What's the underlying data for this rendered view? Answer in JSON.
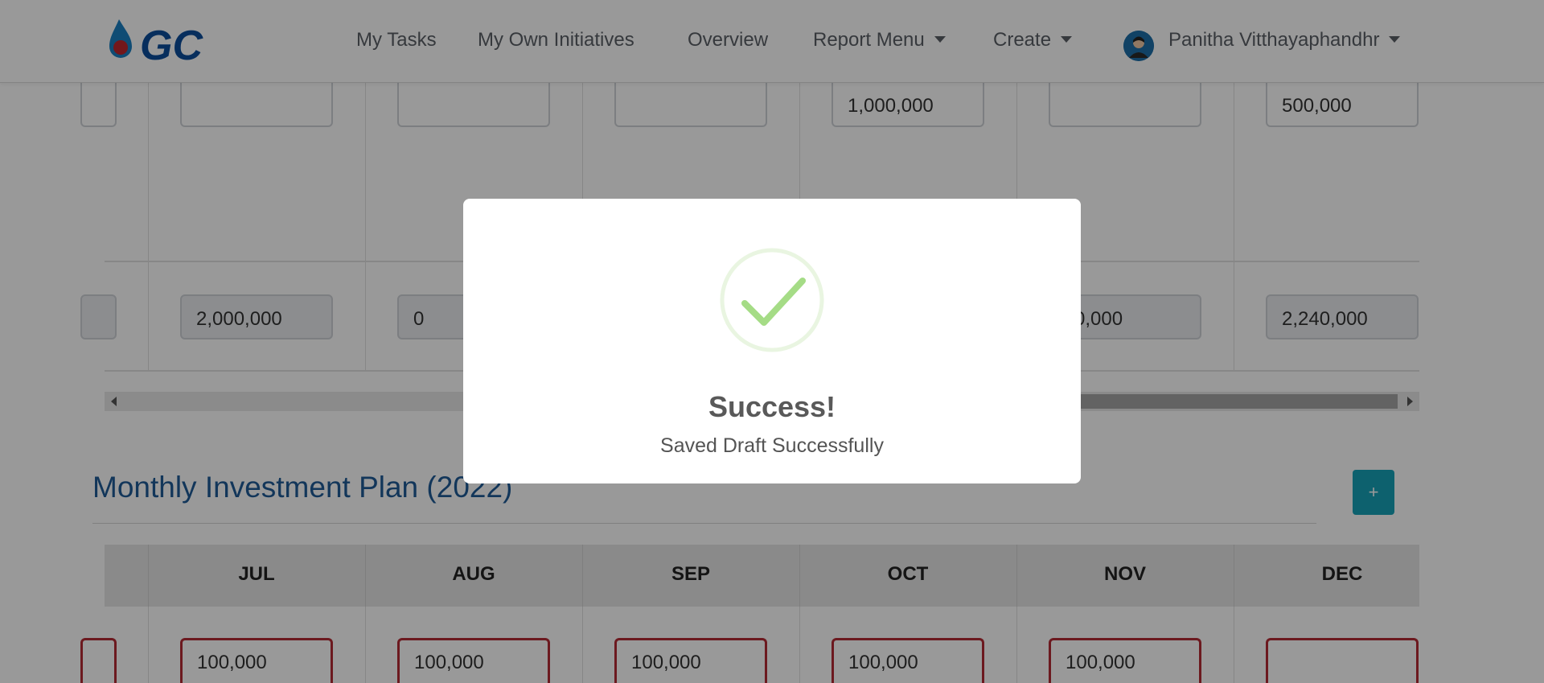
{
  "header": {
    "logo_text": "GC",
    "nav": {
      "my_tasks": "My Tasks",
      "my_own_initiatives": "My Own Initiatives",
      "overview": "Overview",
      "report_menu": "Report Menu",
      "create": "Create"
    },
    "user_name": "Panitha Vitthayaphandhr"
  },
  "upper_table": {
    "row1": [
      "",
      "",
      "",
      "1,000,000",
      "",
      "500,000"
    ],
    "row2": [
      "2,000,000",
      "0",
      "",
      "0,000",
      "2,240,000"
    ]
  },
  "monthly_plan": {
    "title": "Monthly Investment Plan (2022)",
    "add_label": "+",
    "columns": [
      "JUL",
      "AUG",
      "SEP",
      "OCT",
      "NOV",
      "DEC"
    ],
    "values": [
      "100,000",
      "100,000",
      "100,000",
      "100,000",
      "100,000",
      ""
    ]
  },
  "modal": {
    "title": "Success!",
    "message": "Saved Draft Successfully"
  },
  "colors": {
    "brand_blue": "#1e5a97",
    "add_button": "#17a2b8",
    "invalid_border": "#b52a35",
    "success_check": "#a5dc86"
  }
}
